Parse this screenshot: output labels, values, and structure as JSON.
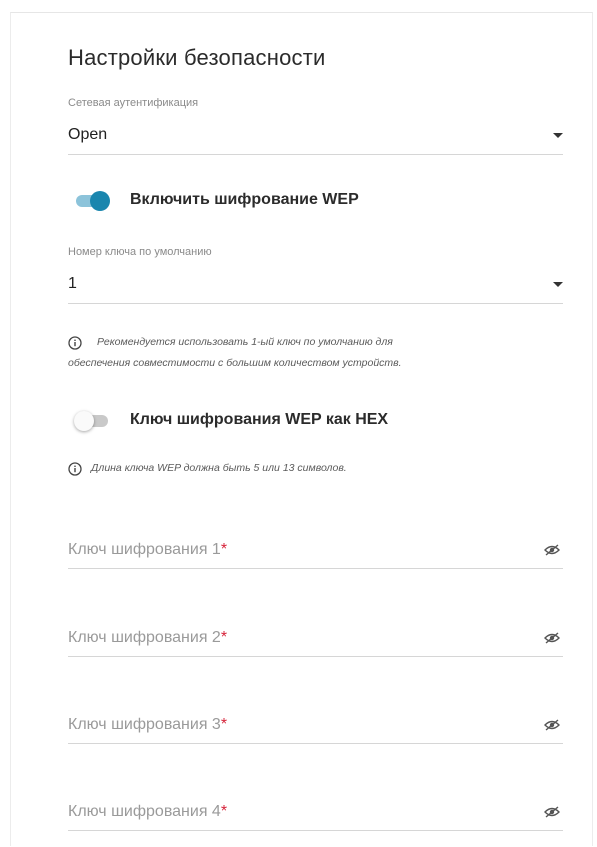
{
  "section": {
    "title": "Настройки безопасности"
  },
  "auth": {
    "label": "Сетевая аутентификация",
    "value": "Open"
  },
  "wep_toggle": {
    "label": "Включить шифрование WEP",
    "enabled": true
  },
  "default_key": {
    "label": "Номер ключа по умолчанию",
    "value": "1"
  },
  "notes": {
    "default_key_line1": "Рекомендуется использовать 1-ый ключ по умолчанию для",
    "default_key_line2": "обеспечения совместимости с большим количеством устройств.",
    "key_length": "Длина ключа WEP должна быть 5 или 13 символов."
  },
  "hex_toggle": {
    "label": "Ключ шифрования WEP как HEX",
    "enabled": false
  },
  "keys": [
    {
      "placeholder": "Ключ шифрования 1",
      "required_mark": "*"
    },
    {
      "placeholder": "Ключ шифрования 2",
      "required_mark": "*"
    },
    {
      "placeholder": "Ключ шифрования 3",
      "required_mark": "*"
    },
    {
      "placeholder": "Ключ шифрования 4",
      "required_mark": "*"
    }
  ],
  "icons": {
    "info": "info-circle-icon",
    "eye": "eye-off-icon",
    "caret": "caret-down-icon"
  },
  "colors": {
    "accent": "#1a86ae",
    "required": "#d6243a"
  }
}
